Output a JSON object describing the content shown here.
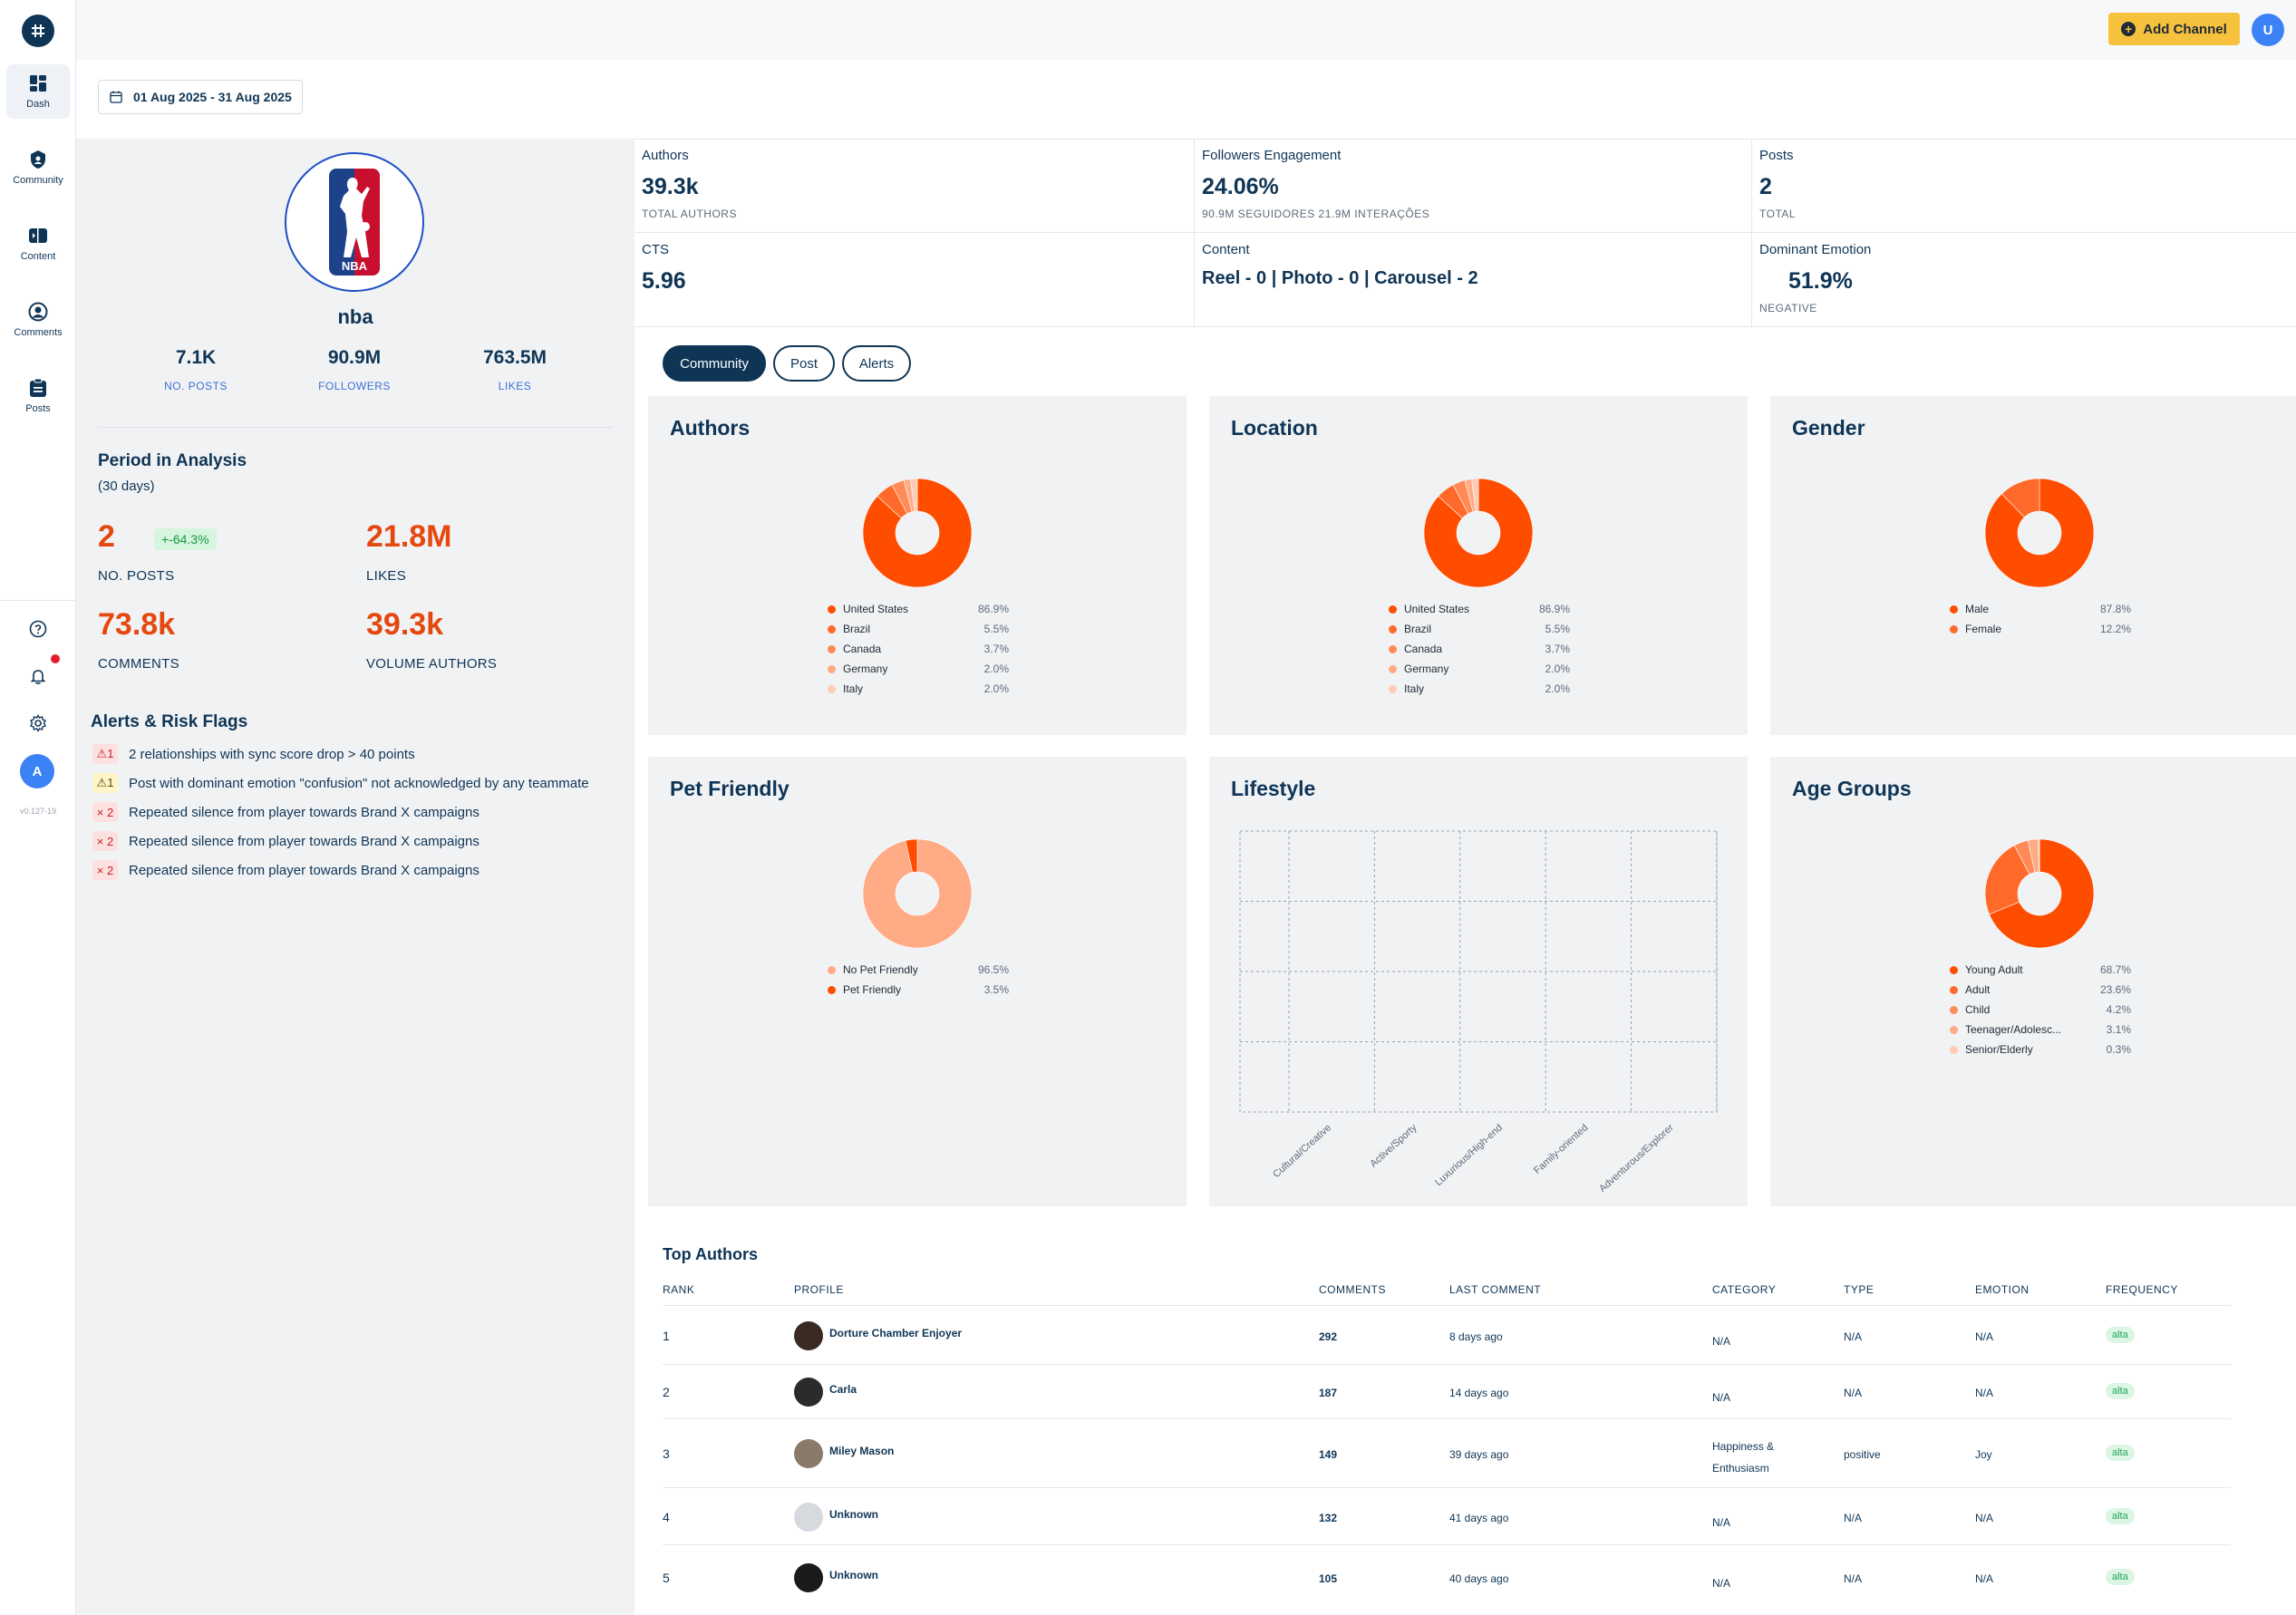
{
  "nav": {
    "items": [
      {
        "label": "Dash",
        "icon": "grid-icon"
      },
      {
        "label": "Community",
        "icon": "shield-icon"
      },
      {
        "label": "Content",
        "icon": "content-icon"
      },
      {
        "label": "Comments",
        "icon": "user-circle-icon"
      },
      {
        "label": "Posts",
        "icon": "clipboard-icon"
      }
    ],
    "avatar_initial": "A",
    "version": "v0.127-19"
  },
  "header": {
    "add_channel_label": "Add Channel",
    "user_initial": "U",
    "date_range": "01 Aug 2025 - 31 Aug 2025"
  },
  "profile": {
    "name": "nba",
    "stats": [
      {
        "value": "7.1K",
        "label": "NO. POSTS"
      },
      {
        "value": "90.9M",
        "label": "FOLLOWERS"
      },
      {
        "value": "763.5M",
        "label": "LIKES"
      }
    ],
    "period_title": "Period in Analysis",
    "period_sub": "(30 days)",
    "period_stats": {
      "posts_value": "2",
      "posts_change": "+-64.3%",
      "posts_label": "NO. POSTS",
      "likes_value": "21.8M",
      "likes_label": "LIKES",
      "comments_value": "73.8k",
      "comments_label": "COMMENTS",
      "authors_value": "39.3k",
      "authors_label": "VOLUME AUTHORS"
    },
    "alerts_title": "Alerts & Risk Flags",
    "alerts": [
      {
        "badge": "⚠1",
        "severity": "warning-red",
        "text": "2 relationships with sync score drop > 40 points"
      },
      {
        "badge": "⚠1",
        "severity": "warning-yellow",
        "text": "Post with dominant emotion \"confusion\" not acknowledged by any teammate"
      },
      {
        "badge": "× 2",
        "severity": "critical",
        "text": "Repeated silence from player towards Brand X campaigns"
      },
      {
        "badge": "× 2",
        "severity": "critical",
        "text": "Repeated silence from player towards Brand X campaigns"
      },
      {
        "badge": "× 2",
        "severity": "critical",
        "text": "Repeated silence from player towards Brand X campaigns"
      }
    ]
  },
  "kpis": {
    "authors": {
      "title": "Authors",
      "value": "39.3k",
      "sub": "TOTAL AUTHORS"
    },
    "engagement": {
      "title": "Followers Engagement",
      "value": "24.06%",
      "sub": "90.9M SEGUIDORES 21.9M INTERAÇÕES"
    },
    "posts": {
      "title": "Posts",
      "value": "2",
      "sub": "TOTAL"
    },
    "cts": {
      "title": "CTS",
      "value": "5.96"
    },
    "content": {
      "title": "Content",
      "value": "Reel - 0 | Photo - 0 | Carousel - 2"
    },
    "emotion": {
      "title": "Dominant Emotion",
      "value": "51.9%",
      "sub": "NEGATIVE"
    }
  },
  "tabs": [
    "Community",
    "Post",
    "Alerts"
  ],
  "colors": {
    "orange1": "#ff4d00",
    "orange2": "#ff6a2b",
    "orange3": "#ff8a57",
    "orange4": "#ffab85",
    "orange5": "#ffcbb2",
    "navy": "#0f3556",
    "accent_yellow": "#f6c23e"
  },
  "chart_data": [
    {
      "type": "pie",
      "title": "Authors",
      "categories": [
        "United States",
        "Brazil",
        "Canada",
        "Germany",
        "Italy"
      ],
      "values": [
        86.9,
        5.5,
        3.7,
        2.0,
        2.0
      ],
      "labels": [
        "86.9%",
        "5.5%",
        "3.7%",
        "2.0%",
        "2.0%"
      ]
    },
    {
      "type": "pie",
      "title": "Location",
      "categories": [
        "United States",
        "Brazil",
        "Canada",
        "Germany",
        "Italy"
      ],
      "values": [
        86.9,
        5.5,
        3.7,
        2.0,
        2.0
      ],
      "labels": [
        "86.9%",
        "5.5%",
        "3.7%",
        "2.0%",
        "2.0%"
      ]
    },
    {
      "type": "pie",
      "title": "Gender",
      "categories": [
        "Male",
        "Female"
      ],
      "values": [
        87.8,
        12.2
      ],
      "labels": [
        "87.8%",
        "12.2%"
      ]
    },
    {
      "type": "pie",
      "title": "Pet Friendly",
      "categories": [
        "No Pet Friendly",
        "Pet Friendly"
      ],
      "values": [
        96.5,
        3.5
      ],
      "labels": [
        "96.5%",
        "3.5%"
      ]
    },
    {
      "type": "bar",
      "title": "Lifestyle",
      "categories": [
        "Cultural/Creative",
        "Active/Sporty",
        "Luxurious/High-end",
        "Family-oriented",
        "Adventurous/Explorer"
      ],
      "values": [],
      "grid": true
    },
    {
      "type": "pie",
      "title": "Age Groups",
      "categories": [
        "Young Adult",
        "Adult",
        "Child",
        "Teenager/Adolesc...",
        "Senior/Elderly"
      ],
      "values": [
        68.7,
        23.6,
        4.2,
        3.1,
        0.3
      ],
      "labels": [
        "68.7%",
        "23.6%",
        "4.2%",
        "3.1%",
        "0.3%"
      ]
    }
  ],
  "top_authors": {
    "title": "Top Authors",
    "columns": [
      "RANK",
      "PROFILE",
      "COMMENTS",
      "LAST COMMENT",
      "CATEGORY",
      "TYPE",
      "EMOTION",
      "FREQUENCY"
    ],
    "rows": [
      {
        "rank": "1",
        "profile": "Dorture Chamber Enjoyer",
        "comments": "292",
        "last": "8 days ago",
        "category": "N/A",
        "type": "N/A",
        "emotion": "N/A",
        "frequency": "alta"
      },
      {
        "rank": "2",
        "profile": "Carla",
        "comments": "187",
        "last": "14 days ago",
        "category": "N/A",
        "type": "N/A",
        "emotion": "N/A",
        "frequency": "alta"
      },
      {
        "rank": "3",
        "profile": "Miley Mason",
        "comments": "149",
        "last": "39 days ago",
        "category": "Happiness & Enthusiasm",
        "type": "positive",
        "emotion": "Joy",
        "frequency": "alta"
      },
      {
        "rank": "4",
        "profile": "Unknown",
        "comments": "132",
        "last": "41 days ago",
        "category": "N/A",
        "type": "N/A",
        "emotion": "N/A",
        "frequency": "alta"
      },
      {
        "rank": "5",
        "profile": "Unknown",
        "comments": "105",
        "last": "40 days ago",
        "category": "N/A",
        "type": "N/A",
        "emotion": "N/A",
        "frequency": "alta"
      }
    ]
  }
}
